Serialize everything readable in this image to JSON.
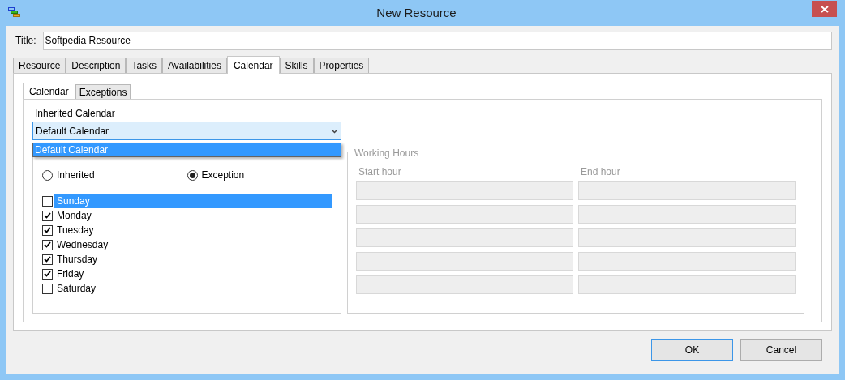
{
  "window": {
    "title": "New Resource"
  },
  "title_field": {
    "label": "Title:",
    "value": "Softpedia Resource"
  },
  "tabs": [
    {
      "label": "Resource",
      "selected": false
    },
    {
      "label": "Description",
      "selected": false
    },
    {
      "label": "Tasks",
      "selected": false
    },
    {
      "label": "Availabilities",
      "selected": false
    },
    {
      "label": "Calendar",
      "selected": true
    },
    {
      "label": "Skills",
      "selected": false
    },
    {
      "label": "Properties",
      "selected": false
    }
  ],
  "subtabs": [
    {
      "label": "Calendar",
      "selected": true
    },
    {
      "label": "Exceptions",
      "selected": false
    }
  ],
  "inherited_calendar": {
    "label": "Inherited Calendar",
    "value": "Default Calendar",
    "expanded": true,
    "options": [
      {
        "label": "Default Calendar",
        "selected": true
      }
    ]
  },
  "working_days": {
    "modes": [
      {
        "label": "Inherited",
        "selected": false
      },
      {
        "label": "Exception",
        "selected": true
      }
    ],
    "days": [
      {
        "label": "Sunday",
        "checked": false,
        "selected": true
      },
      {
        "label": "Monday",
        "checked": true,
        "selected": false
      },
      {
        "label": "Tuesday",
        "checked": true,
        "selected": false
      },
      {
        "label": "Wednesday",
        "checked": true,
        "selected": false
      },
      {
        "label": "Thursday",
        "checked": true,
        "selected": false
      },
      {
        "label": "Friday",
        "checked": true,
        "selected": false
      },
      {
        "label": "Saturday",
        "checked": false,
        "selected": false
      }
    ]
  },
  "working_hours": {
    "title": "Working Hours",
    "columns": [
      "Start hour",
      "End hour"
    ],
    "rows": [
      {
        "disabled": true
      },
      {
        "disabled": true
      },
      {
        "disabled": true
      },
      {
        "disabled": true
      },
      {
        "disabled": true
      }
    ]
  },
  "buttons": [
    {
      "label": "OK",
      "focused": true
    },
    {
      "label": "Cancel",
      "focused": false
    }
  ]
}
